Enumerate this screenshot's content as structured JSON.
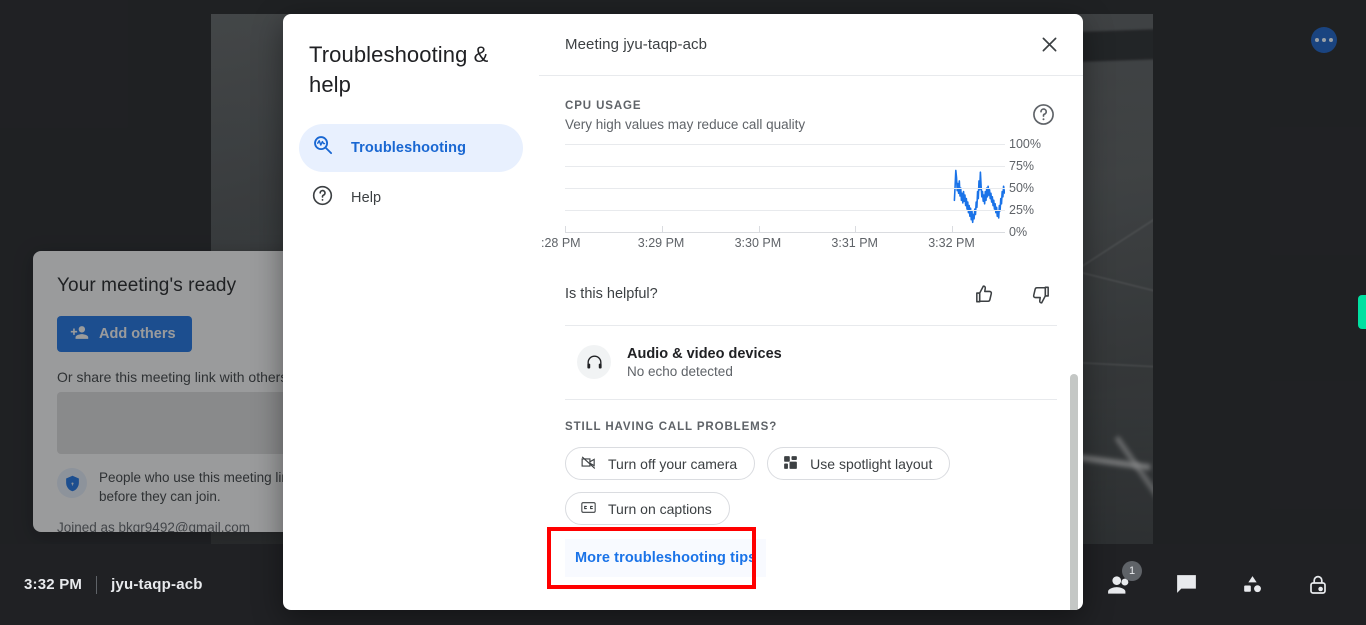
{
  "window": {
    "bottom_bar": {
      "time": "3:32 PM",
      "meeting_code": "jyu-taqp-acb",
      "icons": [
        {
          "name": "meeting-details-icon",
          "glyph": "info"
        },
        {
          "name": "people-icon",
          "glyph": "people",
          "badge": "1"
        },
        {
          "name": "chat-icon",
          "glyph": "chat"
        },
        {
          "name": "activities-icon",
          "glyph": "activities"
        },
        {
          "name": "host-controls-icon",
          "glyph": "lock"
        }
      ]
    },
    "more_options_label": "More options",
    "green_tab_label": "Expand side panel"
  },
  "meeting_card": {
    "title": "Your meeting's ready",
    "add_others_label": "Add others",
    "share_text": "Or share this meeting link with others you want in the meeting",
    "link_value": "",
    "permission_note": "People who use this meeting link must ask for permission before they can join.",
    "joined_as": "Joined as bkgr9492@gmail.com"
  },
  "dialog": {
    "sidebar": {
      "title": "Troubleshooting & help",
      "items": [
        {
          "label": "Troubleshooting",
          "icon": "troubleshooting-icon",
          "active": true
        },
        {
          "label": "Help",
          "icon": "help-circle-icon",
          "active": false
        }
      ]
    },
    "header": {
      "title": "Meeting jyu-taqp-acb",
      "close_label": "Close"
    },
    "cpu_section": {
      "label": "CPU USAGE",
      "subtitle": "Very high values may reduce call quality",
      "help_icon": "help-circle-icon"
    },
    "feedback": {
      "question": "Is this helpful?",
      "thumbs_up_label": "Yes",
      "thumbs_down_label": "No"
    },
    "audio_video": {
      "icon": "headset-icon",
      "title": "Audio & video devices",
      "status": "No echo detected"
    },
    "still_problems": {
      "label": "STILL HAVING CALL PROBLEMS?",
      "chips": [
        {
          "label": "Turn off your camera",
          "icon": "camera-off-icon"
        },
        {
          "label": "Use spotlight layout",
          "icon": "spotlight-layout-icon"
        },
        {
          "label": "Turn on captions",
          "icon": "captions-icon"
        }
      ],
      "more_tips_label": "More troubleshooting tips"
    }
  },
  "colors": {
    "accent_blue": "#1a73e8",
    "active_bg": "#e8f0fe",
    "chart_line": "#1a73e8",
    "highlight_red": "#ff0000",
    "green_tab": "#00e0a1",
    "window_bg": "#202124"
  },
  "chart_data": {
    "type": "line",
    "title": "CPU USAGE",
    "subtitle": "Very high values may reduce call quality",
    "xlabel": "",
    "ylabel": "",
    "ylim": [
      0,
      100
    ],
    "yticks": [
      0,
      25,
      50,
      75,
      100
    ],
    "ytick_labels": [
      "0%",
      "25%",
      "50%",
      "75%",
      "100%"
    ],
    "xtick_labels": [
      ":28 PM",
      "3:29 PM",
      "3:30 PM",
      "3:31 PM",
      "3:32 PM"
    ],
    "grid": true,
    "legend": "none",
    "series": [
      {
        "name": "CPU usage",
        "color": "#1a73e8",
        "x_start_pct": 88.5,
        "values": [
          36,
          52,
          70,
          62,
          47,
          55,
          44,
          58,
          41,
          50,
          36,
          44,
          33,
          46,
          35,
          42,
          30,
          38,
          26,
          34,
          22,
          30,
          18,
          27,
          14,
          24,
          11,
          20,
          15,
          26,
          20,
          34,
          28,
          46,
          38,
          58,
          48,
          68,
          52,
          40,
          46,
          35,
          42,
          32,
          46,
          36,
          50,
          40,
          52,
          42,
          48,
          38,
          44,
          34,
          40,
          30,
          36,
          26,
          32,
          22,
          28,
          18,
          24,
          16,
          30,
          24,
          38,
          32,
          46,
          40,
          52,
          46,
          44
        ]
      }
    ]
  }
}
